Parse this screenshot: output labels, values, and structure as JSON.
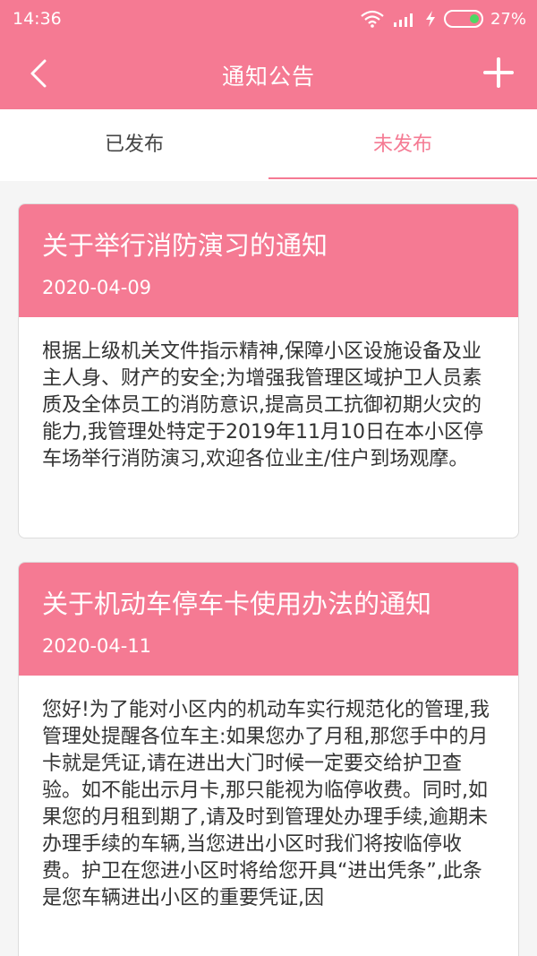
{
  "status_bar": {
    "time": "14:36",
    "battery": "27%"
  },
  "header": {
    "title": "通知公告"
  },
  "tabs": [
    {
      "label": "已发布"
    },
    {
      "label": "未发布"
    }
  ],
  "notices": [
    {
      "title": "关于举行消防演习的通知",
      "date": "2020-04-09",
      "content": "根据上级机关文件指示精神,保障小区设施设备及业主人身、财产的安全;为增强我管理区域护卫人员素质及全体员工的消防意识,提高员工抗御初期火灾的能力,我管理处特定于2019年11月10日在本小区停车场举行消防演习,欢迎各位业主/住户到场观摩。"
    },
    {
      "title": "关于机动车停车卡使用办法的通知",
      "date": "2020-04-11",
      "content": "您好!为了能对小区内的机动车实行规范化的管理,我管理处提醒各位车主:如果您办了月租,那您手中的月卡就是凭证,请在进出大门时候一定要交给护卫查验。如不能出示月卡,那只能视为临停收费。同时,如果您的月租到期了,请及时到管理处办理手续,逾期未办理手续的车辆,当您进出小区时我们将按临停收费。护卫在您进小区时将给您开具“进出凭条”,此条是您车辆进出小区的重要凭证,因"
    }
  ]
}
